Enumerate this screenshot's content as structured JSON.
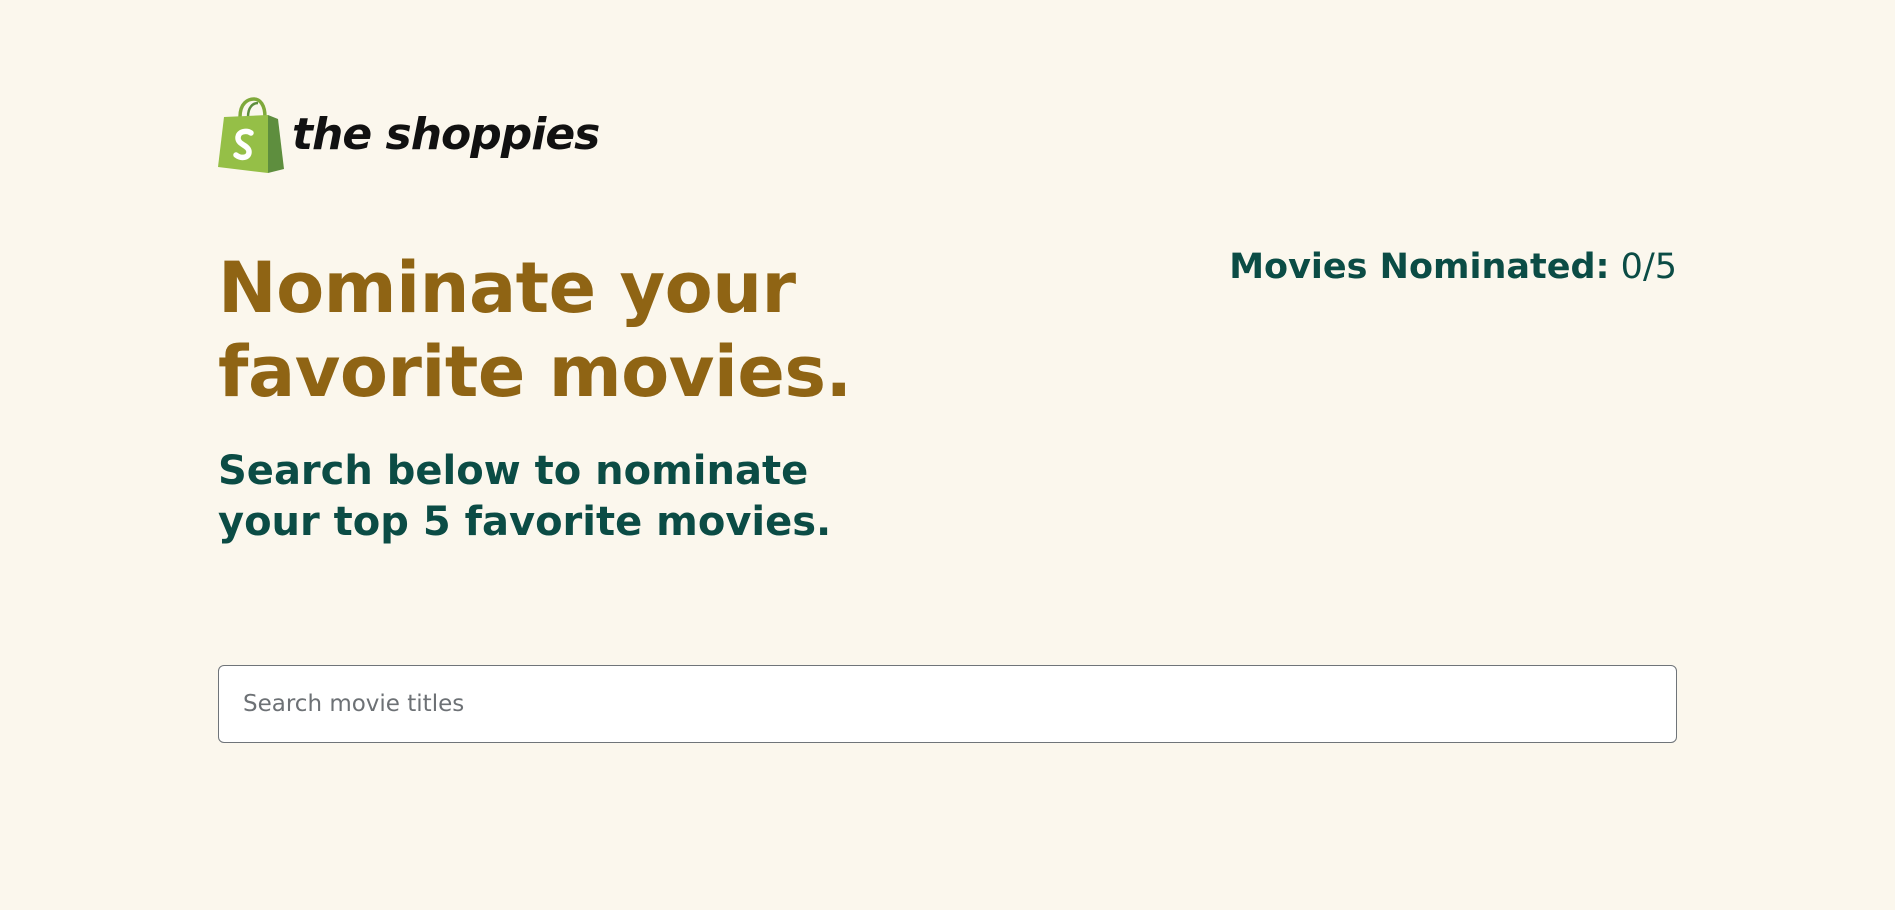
{
  "brand": {
    "logo_icon": "shopify-bag-icon",
    "name": "the shoppies",
    "bag_color": "#95bf47"
  },
  "hero": {
    "headline": "Nominate your favorite movies.",
    "subhead": "Search below to nominate your top 5 favorite movies."
  },
  "nominations": {
    "label": "Movies Nominated:",
    "value": "0/5"
  },
  "search": {
    "placeholder": "Search movie titles",
    "value": ""
  },
  "colors": {
    "background": "#fbf7ed",
    "headline": "#8f6414",
    "accent_text": "#0b4c45"
  }
}
